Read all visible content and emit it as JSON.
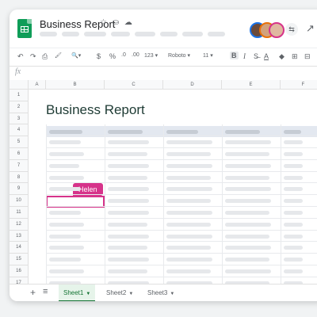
{
  "window": {
    "title": "Business Report",
    "title_icons": "☆ ⛀ ☁"
  },
  "toolbar": {
    "undo": "↶",
    "redo": "↷",
    "print": "⎙",
    "paint": "🖌",
    "zoom": "🔍▾",
    "currency": "$",
    "percent": "%",
    "dec_less": ".0",
    "dec_more": ".00",
    "format_num": "123 ▾",
    "font": "Roboto ▾",
    "size": "11 ▾",
    "bold": "B",
    "italic": "I",
    "strike": "S̶",
    "text_color": "A",
    "fill": "◆",
    "borders": "⊞",
    "merge": "⊟"
  },
  "formula": {
    "fx": "fx"
  },
  "grid": {
    "columns": [
      "A",
      "B",
      "C",
      "D",
      "E",
      "F"
    ],
    "rows": [
      "1",
      "2",
      "3",
      "4",
      "5",
      "6",
      "7",
      "8",
      "9",
      "10",
      "11",
      "12",
      "13",
      "14",
      "15",
      "16",
      "17"
    ],
    "sheet_title": "Business Report"
  },
  "collaborator": {
    "name": "Helen",
    "color": "#d6338a"
  },
  "share": {
    "icon": "⇆"
  },
  "tabs": {
    "add": "+",
    "list": "≡",
    "items": [
      {
        "label": "Sheet1",
        "active": true
      },
      {
        "label": "Sheet2",
        "active": false
      },
      {
        "label": "Sheet3",
        "active": false
      }
    ]
  },
  "colors": {
    "brand": "#0f9d58",
    "accent": "#d6338a"
  }
}
